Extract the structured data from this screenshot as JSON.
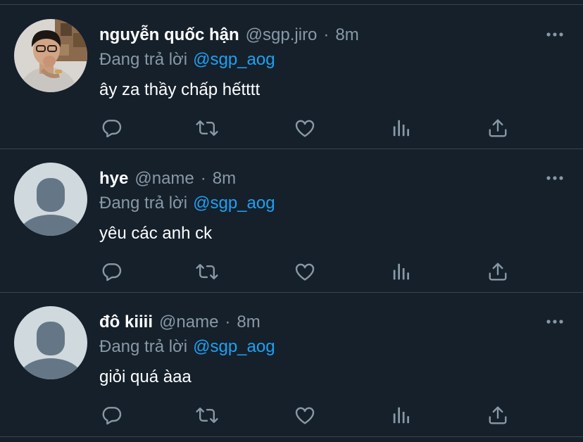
{
  "colors": {
    "background": "#15202b",
    "divider": "#38444d",
    "primary_text": "#ffffff",
    "secondary_text": "#8899a6",
    "accent": "#1da1f2",
    "default_avatar_bg": "#cfd9de",
    "default_avatar_fg": "#657786"
  },
  "tweets": [
    {
      "display_name": "nguyễn quốc hận",
      "handle": "@sgp.jiro",
      "separator": "·",
      "time": "8m",
      "reply_prefix": "Đang trả lời",
      "reply_mention": "@sgp_aog",
      "text": "ây za thầy chấp hếtttt",
      "avatar": "photo-avatar"
    },
    {
      "display_name": "hye",
      "handle": "@name",
      "separator": "·",
      "time": "8m",
      "reply_prefix": "Đang trả lời",
      "reply_mention": "@sgp_aog",
      "text": "yêu các anh ck",
      "avatar": "default-avatar"
    },
    {
      "display_name": "đô kiiii",
      "handle": "@name",
      "separator": "·",
      "time": "8m",
      "reply_prefix": "Đang trả lời",
      "reply_mention": "@sgp_aog",
      "text": "giỏi quá àaa",
      "avatar": "default-avatar"
    }
  ],
  "icons": {
    "more": "more-dots-icon",
    "reply": "reply-bubble-icon",
    "retweet": "retweet-icon",
    "like": "heart-icon",
    "analytics": "analytics-bars-icon",
    "share": "share-upload-icon"
  }
}
